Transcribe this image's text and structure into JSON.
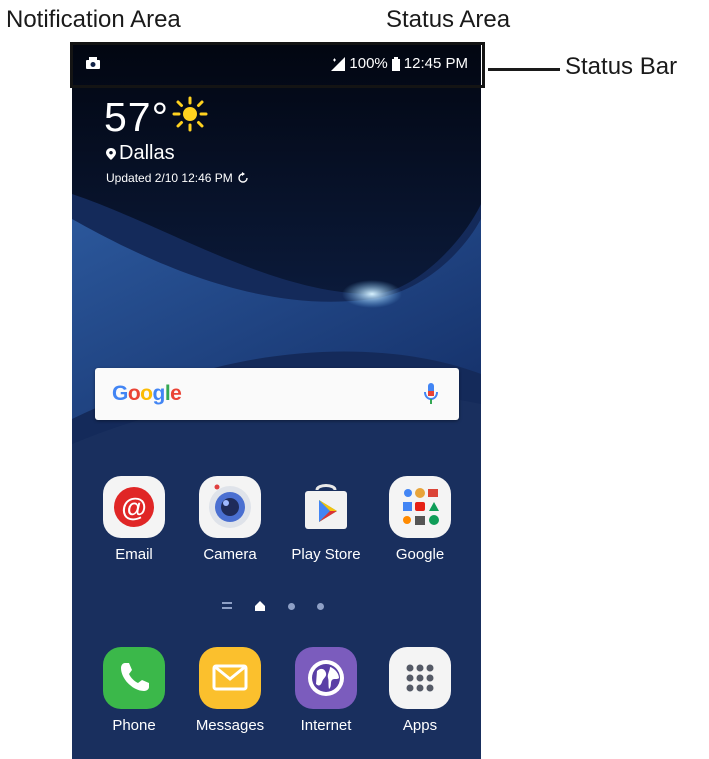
{
  "callouts": {
    "notification_area": "Notification Area",
    "status_area": "Status Area",
    "status_bar": "Status Bar"
  },
  "status": {
    "battery": "100%",
    "time": "12:45 PM"
  },
  "weather": {
    "temperature": "57°",
    "city": "Dallas",
    "updated": "Updated 2/10 12:46 PM"
  },
  "search": {
    "brand": "Google",
    "colors": [
      "#4285F4",
      "#EA4335",
      "#FBBC05",
      "#4285F4",
      "#34A853",
      "#EA4335"
    ]
  },
  "home_apps": [
    {
      "label": "Email",
      "icon": "email-icon"
    },
    {
      "label": "Camera",
      "icon": "camera-icon"
    },
    {
      "label": "Play Store",
      "icon": "play-store-icon"
    },
    {
      "label": "Google",
      "icon": "google-folder-icon"
    }
  ],
  "dock_apps": [
    {
      "label": "Phone",
      "icon": "phone-icon"
    },
    {
      "label": "Messages",
      "icon": "messages-icon"
    },
    {
      "label": "Internet",
      "icon": "internet-icon"
    },
    {
      "label": "Apps",
      "icon": "apps-grid-icon"
    }
  ]
}
